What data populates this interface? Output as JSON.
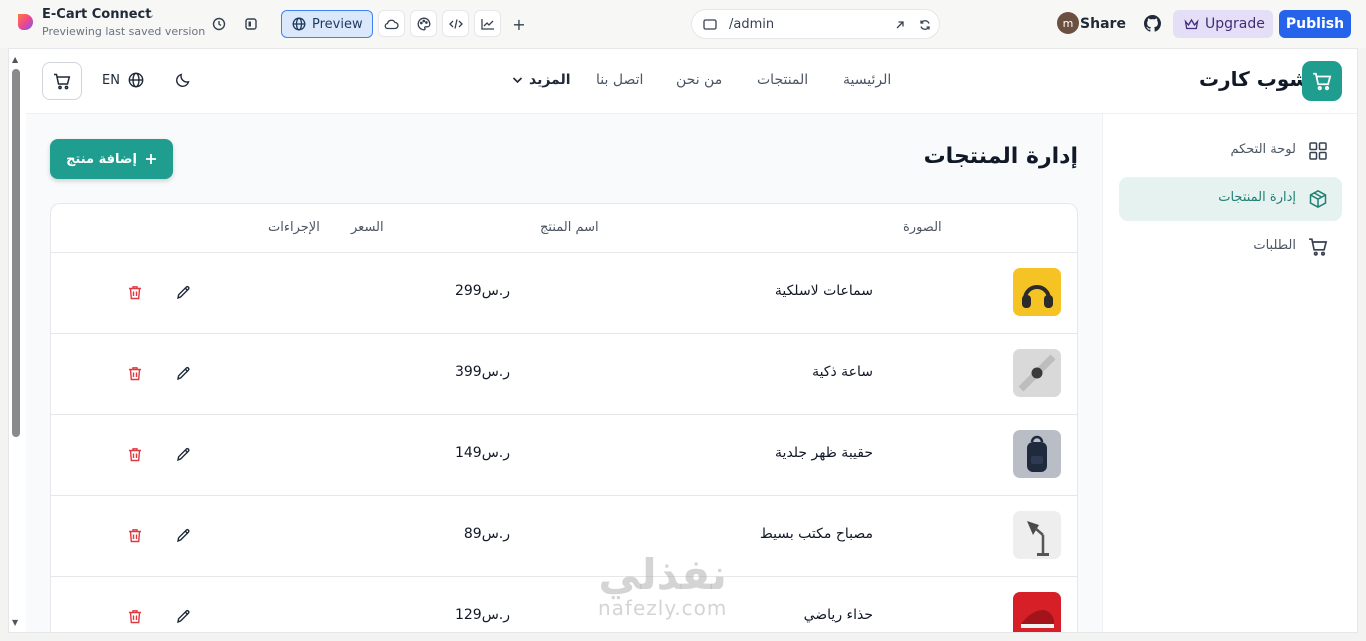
{
  "editor": {
    "project_name": "E-Cart Connect",
    "project_status": "Previewing last saved version",
    "preview_label": "Preview",
    "url": "/admin",
    "avatar_letter": "m",
    "share_label": "Share",
    "upgrade_label": "Upgrade",
    "publish_label": "Publish",
    "colors": {
      "publish": "#2563eb",
      "upgrade": "#e4def7",
      "preview": "#dbe8fb"
    }
  },
  "site": {
    "brand": "شوب كارت",
    "language": "EN",
    "nav": [
      "الرئيسية",
      "المنتجات",
      "من نحن",
      "اتصل بنا"
    ],
    "nav_more": "المزيد",
    "accent": "#1f9e8f"
  },
  "sidebar": {
    "items": [
      {
        "label": "لوحة التحكم",
        "icon": "dashboard-grid-icon"
      },
      {
        "label": "إدارة المنتجات",
        "icon": "package-box-icon",
        "active": true
      },
      {
        "label": "الطلبات",
        "icon": "cart-icon"
      }
    ]
  },
  "main": {
    "title": "إدارة المنتجات",
    "add_button": "إضافة منتج",
    "columns": [
      "الصورة",
      "اسم المنتج",
      "السعر",
      "الإجراءات"
    ],
    "products": [
      {
        "name": "سماعات لاسلكية",
        "price": "299ر.س",
        "image": "yellow-headphones"
      },
      {
        "name": "ساعة ذكية",
        "price": "399ر.س",
        "image": "smart-watch"
      },
      {
        "name": "حقيبة ظهر جلدية",
        "price": "149ر.س",
        "image": "leather-backpack"
      },
      {
        "name": "مصباح مكتب بسيط",
        "price": "89ر.س",
        "image": "desk-lamp"
      },
      {
        "name": "حذاء رياضي",
        "price": "129ر.س",
        "image": "red-sneaker"
      }
    ]
  },
  "watermark": {
    "arabic": "نفذلي",
    "latin": "nafezly.com"
  }
}
